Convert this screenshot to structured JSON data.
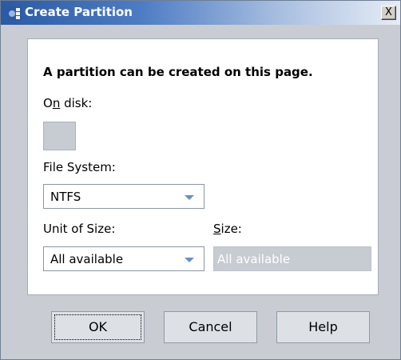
{
  "window": {
    "title": "Create Partition",
    "close_label": "X",
    "icon": "partition-app-icon"
  },
  "form": {
    "heading": "A partition can be created on this page.",
    "on_disk_label_pre": "O",
    "on_disk_label_u": "n",
    "on_disk_label_post": " disk:",
    "file_system_label": "File System:",
    "file_system_value": "NTFS",
    "unit_label": "Unit of Size:",
    "unit_value": "All available",
    "size_label_u": "S",
    "size_label_post": "ize:",
    "size_value": "All available"
  },
  "buttons": {
    "ok": "OK",
    "cancel": "Cancel",
    "help": "Help"
  },
  "colors": {
    "title_gradient_start": "#2b5aa5",
    "dialog_background": "#c9cdd3",
    "dropdown_arrow": "#6a8fc7"
  }
}
